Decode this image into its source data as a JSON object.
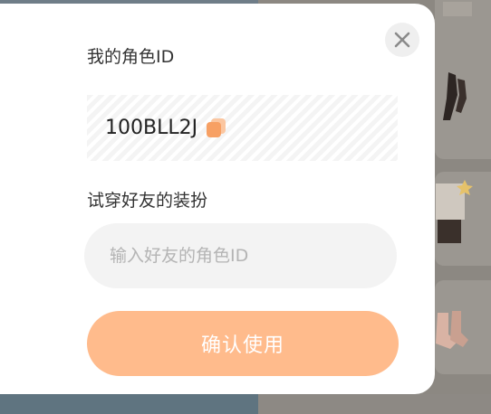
{
  "dialog": {
    "my_id_label": "我的角色ID",
    "my_id_value": "100BLL2J",
    "try_label": "试穿好友的装扮",
    "friend_input_placeholder": "输入好友的角色ID",
    "friend_input_value": "",
    "confirm_label": "确认使用"
  },
  "icons": {
    "close": "close-icon",
    "copy": "copy-icon"
  },
  "colors": {
    "confirm_button": "#ffbb8c",
    "copy_icon": "#f7a064",
    "input_background": "#f3f3f3",
    "overlay": "#6f7d88"
  }
}
